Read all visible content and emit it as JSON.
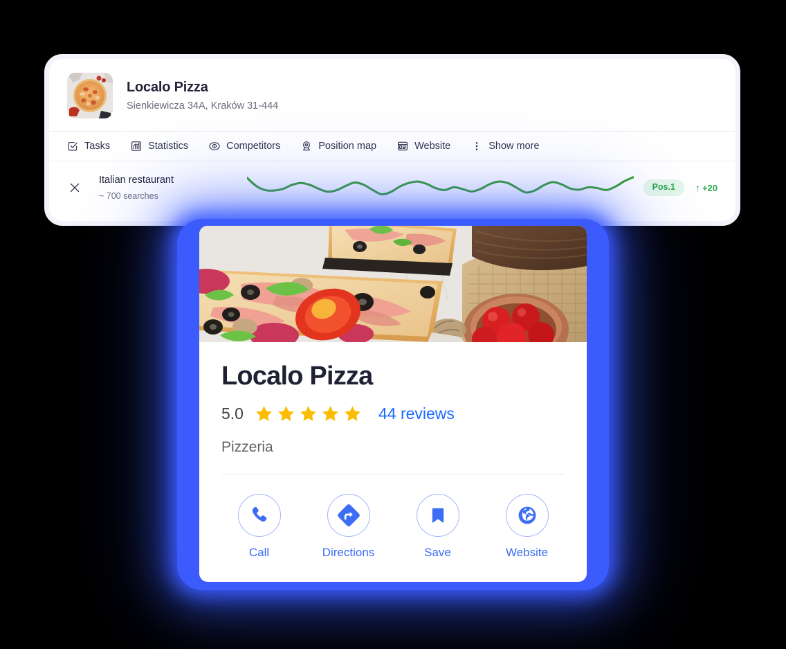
{
  "dashboard": {
    "business": {
      "thumbnail_icon": "pizza-photo-thumbnail",
      "name": "Localo Pizza",
      "address": "Sienkiewicza 34A, Kraków 31-444"
    },
    "tabs": [
      {
        "label": "Tasks",
        "icon": "checkbox-check-icon"
      },
      {
        "label": "Statistics",
        "icon": "chart-bar-icon"
      },
      {
        "label": "Competitors",
        "icon": "eye-icon"
      },
      {
        "label": "Position map",
        "icon": "map-pin-icon"
      },
      {
        "label": "Website",
        "icon": "browser-window-icon"
      },
      {
        "label": "Show more",
        "icon": "dots-vertical-icon"
      }
    ],
    "keyword_row": {
      "close_icon": "close-x-icon",
      "keyword": "Italian restaurant",
      "searches": "~ 700 searches",
      "position_badge": "Pos.1",
      "delta_arrow": "↑",
      "delta_value": "+20",
      "badge_bg_color": "#e4f6e9",
      "badge_text_color": "#2aa84a",
      "line_color": "#3aa02e"
    }
  },
  "chart_data": {
    "type": "line",
    "title": "",
    "subtitle": "",
    "xlabel": "",
    "ylabel": "",
    "legend": [],
    "grid": false,
    "series": [
      {
        "name": "Italian restaurant position trend",
        "color": "#3aa02e",
        "values": [
          0.92,
          0.58,
          0.4,
          0.38,
          0.45,
          0.62,
          0.7,
          0.62,
          0.45,
          0.33,
          0.4,
          0.58,
          0.72,
          0.62,
          0.4,
          0.22,
          0.32,
          0.55,
          0.7,
          0.76,
          0.66,
          0.48,
          0.4,
          0.52,
          0.44,
          0.34,
          0.45,
          0.65,
          0.76,
          0.7,
          0.5,
          0.3,
          0.38,
          0.6,
          0.74,
          0.64,
          0.46,
          0.42,
          0.52,
          0.48,
          0.4,
          0.55,
          0.78,
          0.95
        ]
      }
    ],
    "ylim": [
      0,
      1
    ],
    "x": []
  },
  "gmb_card": {
    "hero_image_icon": "pizza-photo-hero",
    "title": "Localo Pizza",
    "rating": "5.0",
    "stars_filled": 5,
    "star_color": "#fbbc04",
    "reviews_label": "44 reviews",
    "reviews_color": "#1a6aff",
    "category": "Pizzeria",
    "accent_color": "#3b6df5",
    "actions": [
      {
        "label": "Call",
        "icon": "phone-icon"
      },
      {
        "label": "Directions",
        "icon": "directions-diamond-icon"
      },
      {
        "label": "Save",
        "icon": "bookmark-icon"
      },
      {
        "label": "Website",
        "icon": "globe-icon"
      }
    ]
  }
}
